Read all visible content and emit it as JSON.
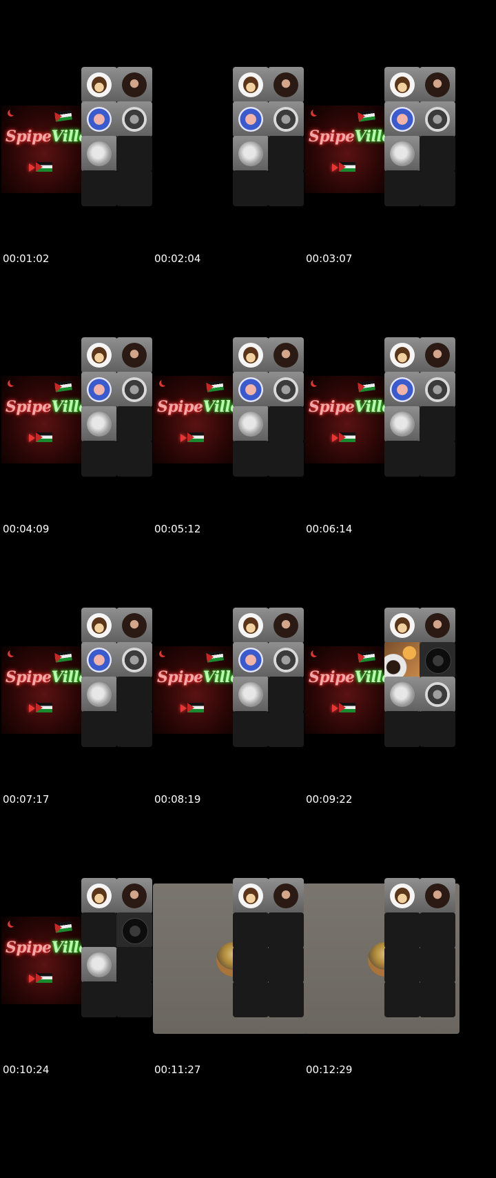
{
  "banner": {
    "word1": "Spipe",
    "word2": "Ville"
  },
  "frames": [
    {
      "timestamp": "00:01:02",
      "banner": true
    },
    {
      "timestamp": "00:02:04",
      "banner": false
    },
    {
      "timestamp": "00:03:07",
      "banner": true
    },
    {
      "timestamp": "00:04:09",
      "banner": true
    },
    {
      "timestamp": "00:05:12",
      "banner": true
    },
    {
      "timestamp": "00:06:14",
      "banner": true
    },
    {
      "timestamp": "00:07:17",
      "banner": true
    },
    {
      "timestamp": "00:08:19",
      "banner": true
    },
    {
      "timestamp": "00:09:22",
      "banner": true
    },
    {
      "timestamp": "00:10:24",
      "banner": true
    },
    {
      "timestamp": "00:11:27",
      "banner": false,
      "card": true
    },
    {
      "timestamp": "00:12:29",
      "banner": false,
      "card": true
    }
  ],
  "grid_layouts": {
    "full": [
      "monkey-avatar",
      "woman-avatar",
      "clown-avatar",
      "dog-avatar",
      "stone-avatar",
      "empty",
      "empty",
      "empty"
    ],
    "frame9": [
      "monkey-avatar",
      "woman-avatar",
      "food-video",
      "dark-avatar",
      "stone-avatar",
      "dog-avatar",
      "empty",
      "empty"
    ],
    "frame10": [
      "monkey-avatar",
      "woman-avatar",
      "empty",
      "dark-avatar",
      "stone-avatar",
      "empty",
      "empty",
      "empty"
    ],
    "card": [
      "monkey-avatar",
      "woman-avatar",
      "empty",
      "empty",
      "empty",
      "empty",
      "empty",
      "empty"
    ]
  }
}
